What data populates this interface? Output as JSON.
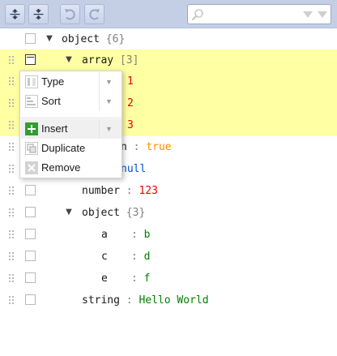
{
  "toolbar": {
    "expand_all_icon": "expand-all-icon",
    "collapse_all_icon": "collapse-all-icon",
    "undo_icon": "undo-icon",
    "redo_icon": "redo-icon",
    "search": {
      "value": "",
      "placeholder": ""
    }
  },
  "tree": {
    "root": {
      "key": "object",
      "count": "{6}"
    },
    "array": {
      "key": "array",
      "count": "[3]",
      "items": [
        "1",
        "2",
        "3"
      ]
    },
    "boolean": {
      "key_visible": "n",
      "value": "true"
    },
    "null_value": "null",
    "number": {
      "key": "number",
      "value": "123"
    },
    "object": {
      "key": "object",
      "count": "{3}"
    },
    "a": {
      "key": "a",
      "value": "b"
    },
    "c": {
      "key": "c",
      "value": "d"
    },
    "e": {
      "key": "e",
      "value": "f"
    },
    "string": {
      "key": "string",
      "value": "Hello World"
    },
    "separator": ":"
  },
  "menu": {
    "type_label": "Type",
    "sort_label": "Sort",
    "insert_label": "Insert",
    "duplicate_label": "Duplicate",
    "remove_label": "Remove"
  },
  "colors": {
    "toolbar_bg": "#c4cfe6",
    "highlight": "#ffffa3",
    "number": "#ee0000",
    "boolean": "#ff8c00",
    "null": "#004ed0",
    "string": "#008000",
    "insert_icon": "#2ea02e"
  }
}
